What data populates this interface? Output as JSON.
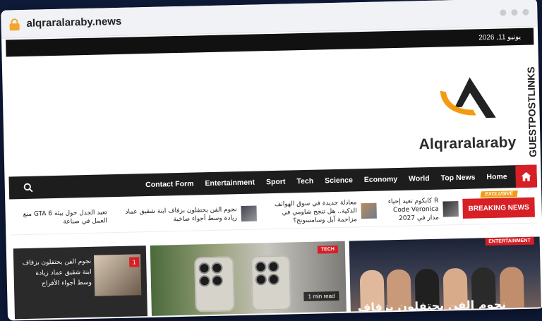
{
  "browser": {
    "url": "alqraralaraby.news"
  },
  "topbar": {
    "date": "يونيو 11, 2026"
  },
  "header": {
    "logo_text": "Alqraralaraby",
    "side_brand": "GUESTPOSTLINKS"
  },
  "nav": {
    "items": [
      "Contact Form",
      "Entertainment",
      "Sport",
      "Tech",
      "Science",
      "Economy",
      "World",
      "Top News",
      "Home"
    ]
  },
  "ticker": {
    "label": "BREAKING NEWS",
    "exclusive": "EXCLUSIVE",
    "items": [
      {
        "text": "R كابكوم تعيد إحياء Code Veronica مدار في 2027"
      },
      {
        "text": "معادلة جديدة في سوق الهواتف الذكية.. هل تنجح شاومي في مزاحمة آبل وسامسونج؟"
      },
      {
        "text": "نجوم الفن يحتفلون بزفاف ابنة شقيق عماد زيادة وسط أجواء صاخبة"
      },
      {
        "text": "تعيد الجدل حول بيئة GTA 6 منع العمل في صناعة"
      }
    ]
  },
  "cards": {
    "left": {
      "number": "1",
      "title": "نجوم الفن يحتفلون بزفاف ابنة شقيق عماد زيادة وسط أجواء الأفراح"
    },
    "middle": {
      "tag": "TECH",
      "read": "1 min read"
    },
    "right": {
      "tag": "ENTERTAINMENT",
      "title": "نجوم الفن يحتفلون بزفاف"
    }
  },
  "colors": {
    "accent": "#d71f26",
    "logo_orange": "#f39c12",
    "nav_bg": "#1d1d1d"
  }
}
